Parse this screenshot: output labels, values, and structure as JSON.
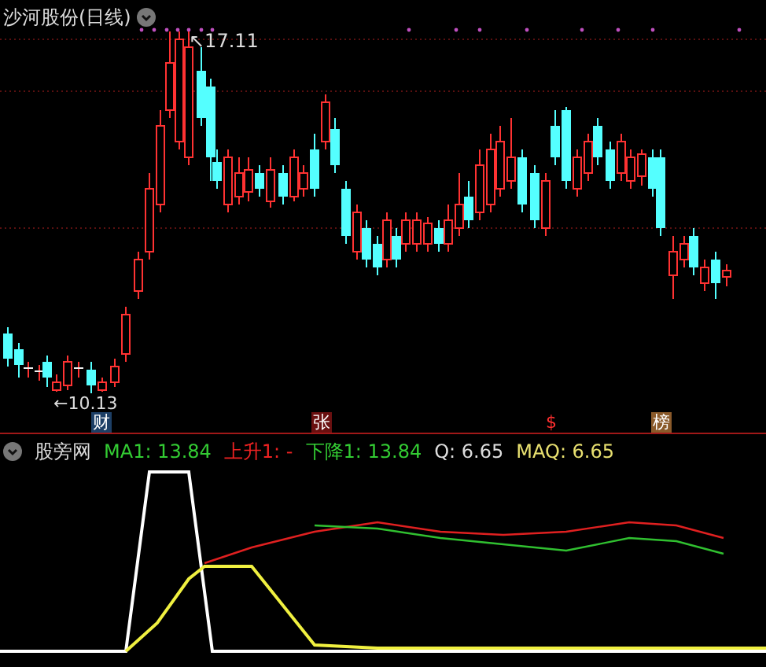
{
  "title": "沙河股份(日线)",
  "price_chart": {
    "high_label": "↖17.11",
    "low_label": "←10.13",
    "event_markers": [
      {
        "text": "财",
        "color": "#1d3f66"
      },
      {
        "text": "张",
        "color": "#6a1010"
      },
      {
        "text": "$",
        "color": "#000000"
      },
      {
        "text": "榜",
        "color": "#8a5a2a"
      }
    ]
  },
  "indicator": {
    "name": "股旁网",
    "values": [
      {
        "text": "MA1: 13.84",
        "color": "#33cc33"
      },
      {
        "text": "上升1: -",
        "color": "#ee2222"
      },
      {
        "text": "下降1: 13.84",
        "color": "#33cc33"
      },
      {
        "text": "Q: 6.65",
        "color": "#dddddd"
      },
      {
        "text": "MAQ: 6.65",
        "color": "#e8e070"
      }
    ]
  }
}
